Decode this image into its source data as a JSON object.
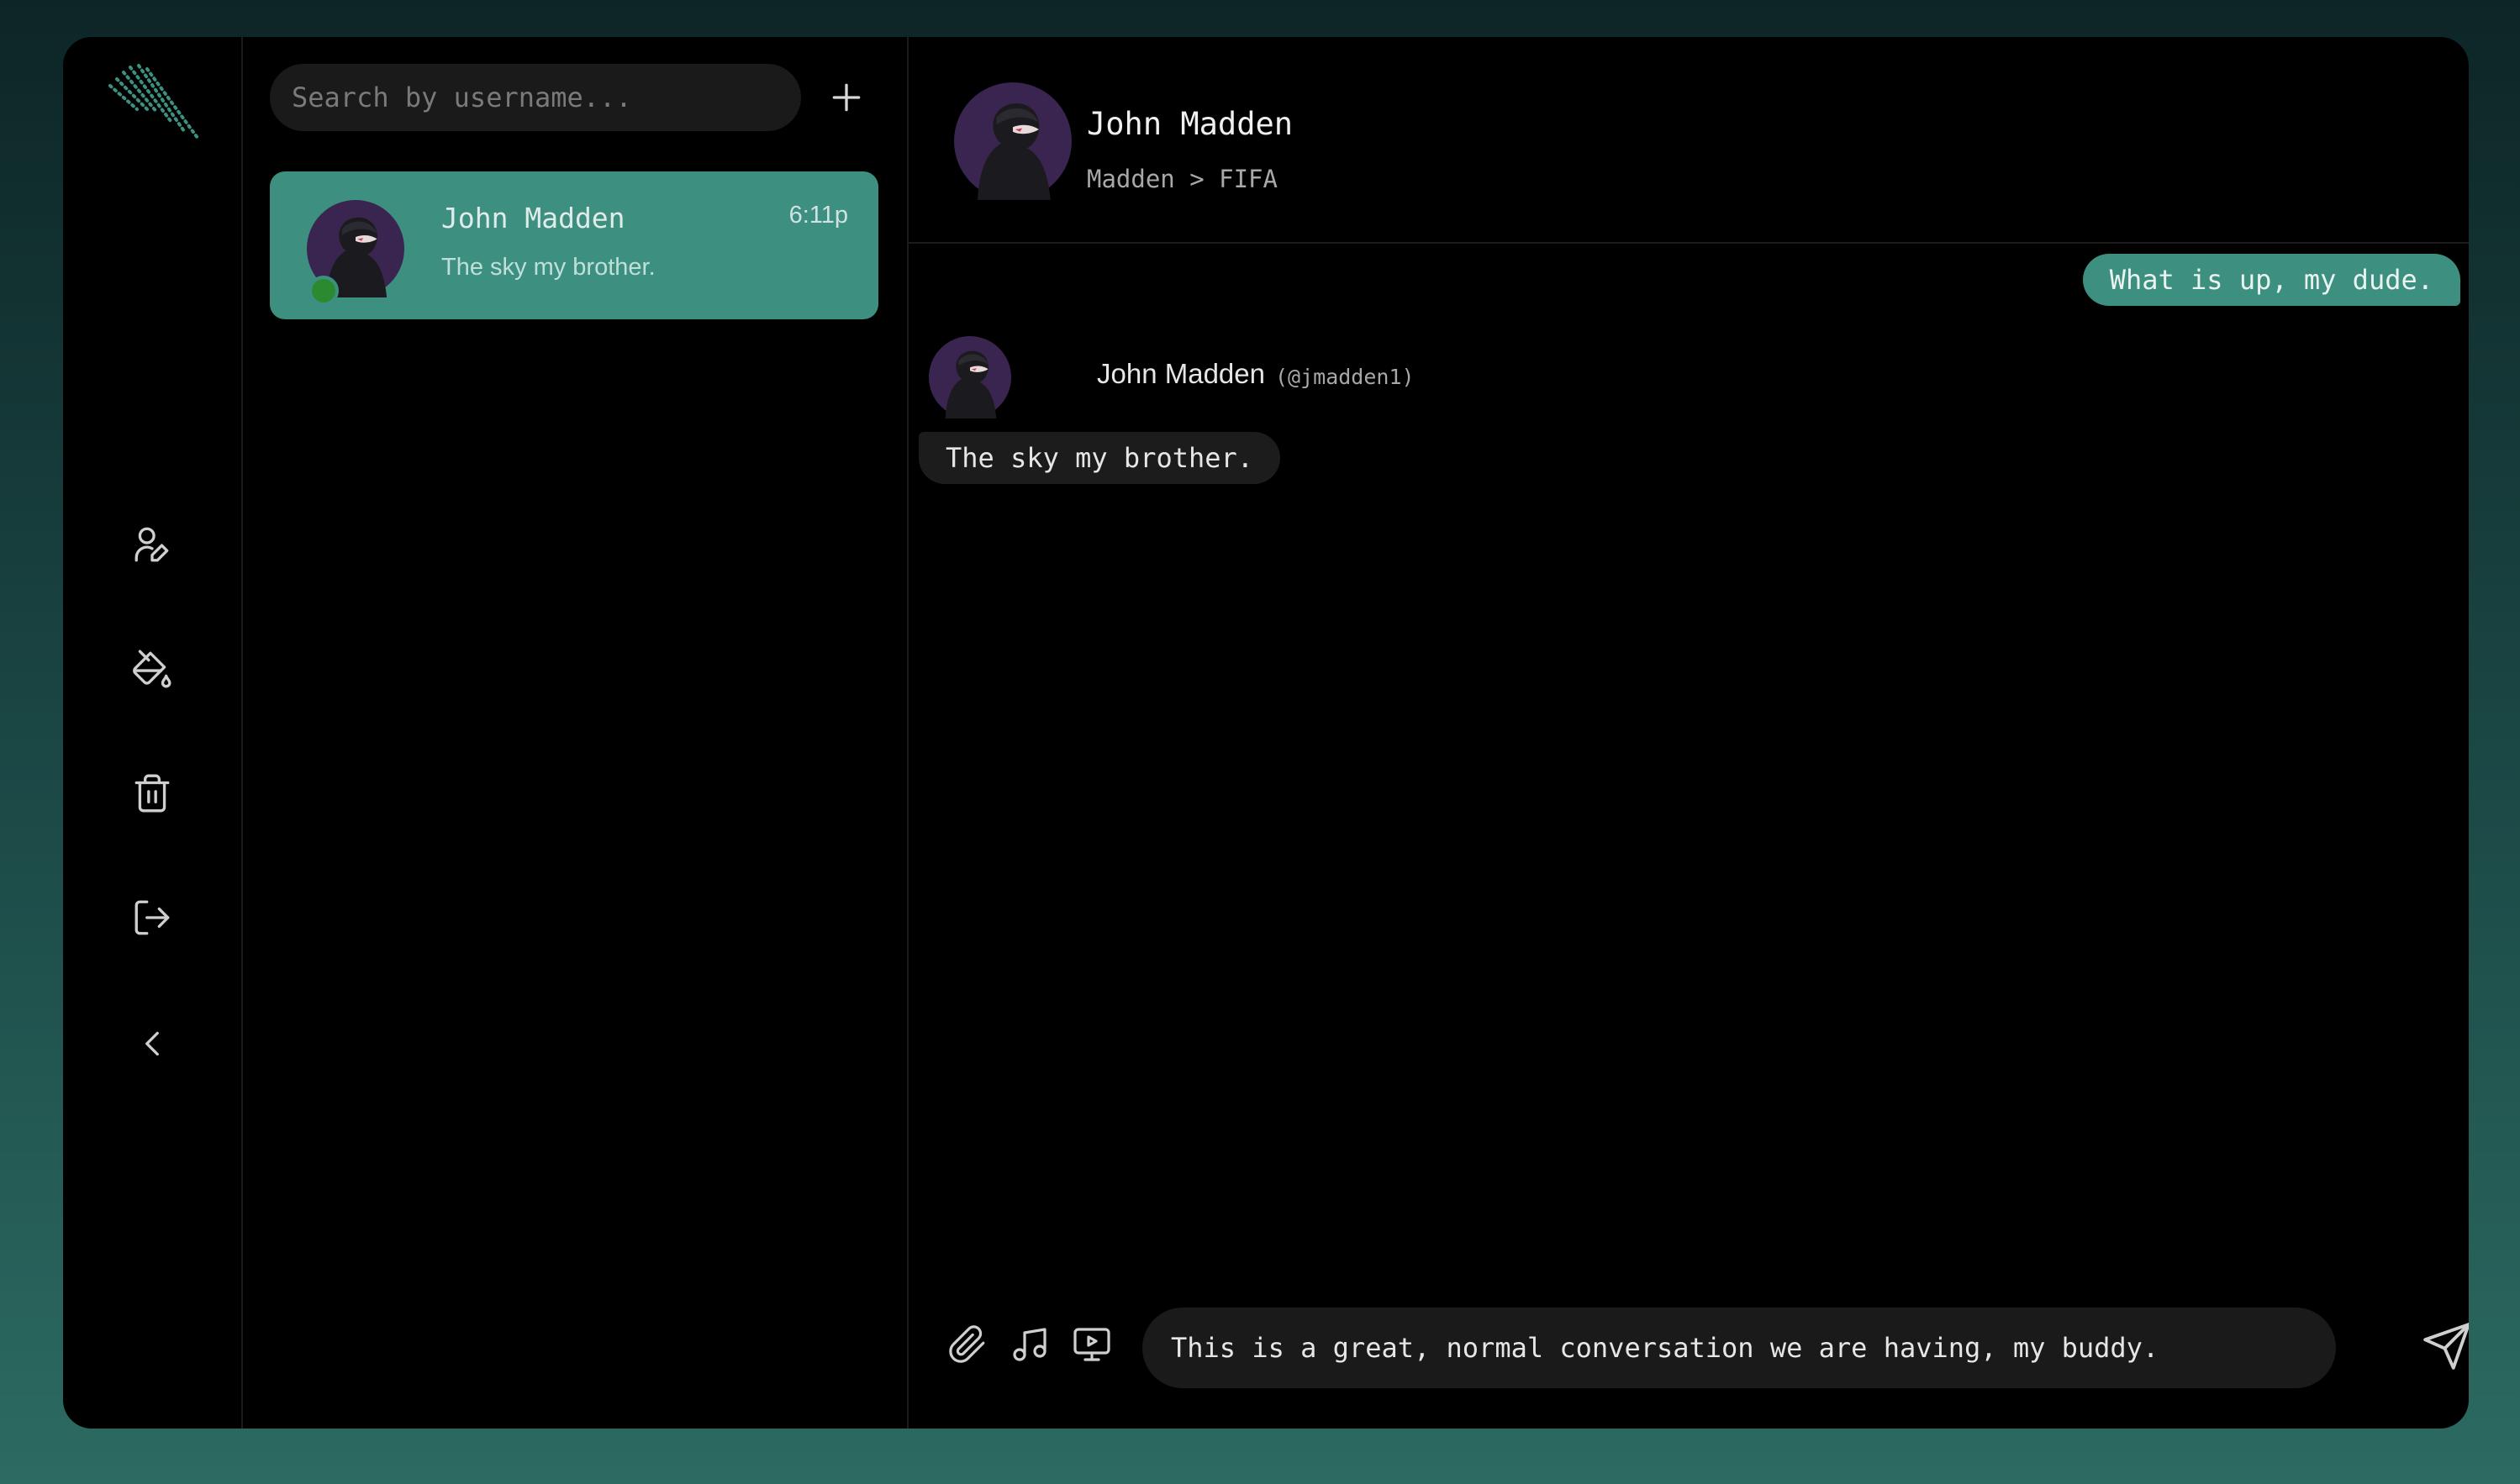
{
  "search": {
    "placeholder": "Search by username..."
  },
  "conversations": [
    {
      "name": "John Madden",
      "time": "6:11p",
      "preview": "The sky my brother.",
      "online": true
    }
  ],
  "chat": {
    "header": {
      "name": "John Madden",
      "status": "Madden > FIFA"
    },
    "messages": [
      {
        "direction": "outgoing",
        "text": "What is up, my dude."
      },
      {
        "direction": "incoming",
        "sender": "John Madden",
        "handle": "(@jmadden1)",
        "text": "The sky my brother."
      }
    ],
    "composer": {
      "value": "This is a great, normal conversation we are having, my buddy."
    }
  },
  "icons": {
    "rail": [
      "logo-icon",
      "edit-profile-icon",
      "paint-bucket-icon",
      "trash-icon",
      "logout-icon",
      "chevron-left-icon"
    ],
    "list": [
      "plus-icon"
    ],
    "composer": [
      "paperclip-icon",
      "music-icon",
      "screen-share-icon",
      "send-icon"
    ]
  },
  "colors": {
    "accent": "#3d8f80",
    "online": "#2b8a30",
    "panel": "#000000",
    "input": "#1a1a1a"
  }
}
